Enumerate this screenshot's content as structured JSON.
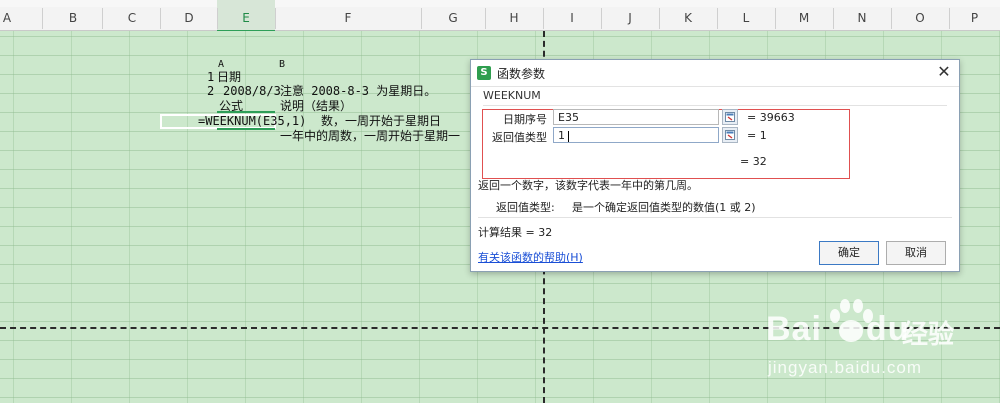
{
  "columns": [
    "A",
    "B",
    "C",
    "D",
    "E",
    "F",
    "G",
    "H",
    "I",
    "J",
    "K",
    "L",
    "M",
    "N",
    "O",
    "P"
  ],
  "selected_column": "E",
  "sheet_text": {
    "header_a": "A",
    "header_b": "B",
    "row1_num": "1",
    "row1_text": "日期",
    "row2_num": "2",
    "row2_date": "2008/8/3",
    "row2_note": "注意 2008-8-3 为星期日。",
    "formula_label": "公式",
    "desc_label": "说明（结果）",
    "formula_cell": "=WEEKNUM(E35,1)",
    "desc_row1": "数，一周开始于星期日",
    "desc_row2": "一年中的周数，一周开始于星期一"
  },
  "dialog": {
    "title": "函数参数",
    "logo": "S",
    "close_glyph": "✕",
    "function_name": "WEEKNUM",
    "args": [
      {
        "label": "日期序号",
        "value": "E35",
        "result": "= 39663"
      },
      {
        "label": "返回值类型",
        "value": "1",
        "result": "= 1"
      }
    ],
    "formula_result": "= 32",
    "description": "返回一个数字，该数字代表一年中的第几周。",
    "arg_help_label": "返回值类型:",
    "arg_help_text": "是一个确定返回值类型的数值(1 或 2)",
    "calc_result": "计算结果 = 32",
    "help_link": "有关该函数的帮助(H)",
    "ok_label": "确定",
    "cancel_label": "取消"
  },
  "watermark": {
    "brand": "Bai",
    "brand_tail": "du",
    "brand_cn": "经验",
    "url": "jingyan.baidu.com"
  },
  "colors": {
    "sheet_bg": "#cce8cc",
    "accent_green": "#2e9e58",
    "dialog_highlight": "#e05050",
    "link": "#1a4fd6"
  }
}
